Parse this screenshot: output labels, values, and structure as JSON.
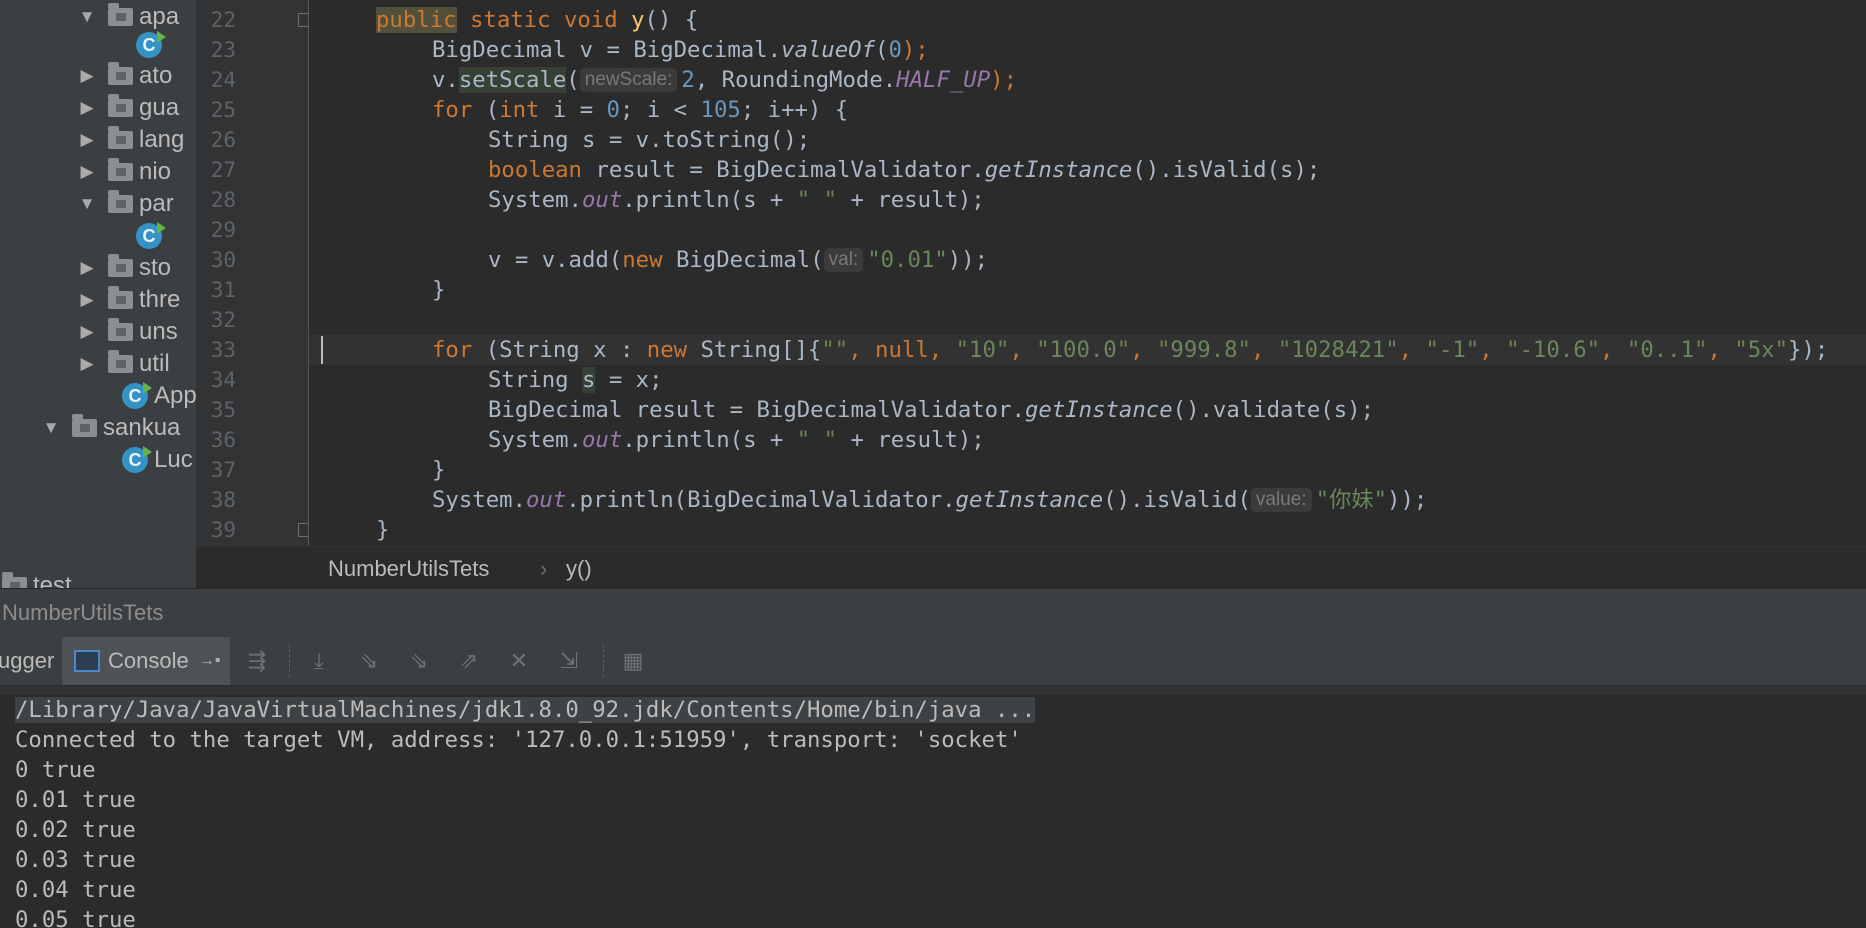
{
  "project_tree": {
    "items": [
      {
        "label": "apa",
        "icon": "folder-icon",
        "expanded": true
      },
      {
        "label": "C",
        "icon": "class-icon"
      },
      {
        "label": "ato",
        "icon": "folder-icon",
        "expanded": false
      },
      {
        "label": "gua",
        "icon": "folder-icon",
        "expanded": false
      },
      {
        "label": "lang",
        "icon": "folder-icon",
        "expanded": false
      },
      {
        "label": "nio",
        "icon": "folder-icon",
        "expanded": false
      },
      {
        "label": "par",
        "icon": "folder-icon",
        "expanded": true
      },
      {
        "label": "C",
        "icon": "class-icon"
      },
      {
        "label": "sto",
        "icon": "folder-icon",
        "expanded": false
      },
      {
        "label": "thre",
        "icon": "folder-icon",
        "expanded": false
      },
      {
        "label": "uns",
        "icon": "folder-icon",
        "expanded": false
      },
      {
        "label": "util",
        "icon": "folder-icon",
        "expanded": false
      },
      {
        "label": "App",
        "icon": "class-icon"
      },
      {
        "label": "sankua",
        "icon": "folder-icon",
        "expanded": true
      },
      {
        "label": "Luc",
        "icon": "class-icon"
      },
      {
        "label": "test",
        "icon": "folder-icon"
      }
    ]
  },
  "editor": {
    "line_numbers": [
      "22",
      "23",
      "24",
      "25",
      "26",
      "27",
      "28",
      "29",
      "30",
      "31",
      "32",
      "33",
      "34",
      "35",
      "36",
      "37",
      "38",
      "39"
    ],
    "code": {
      "l22": [
        "public",
        " ",
        "static void",
        " ",
        "y",
        "() {"
      ],
      "l23": [
        "BigDecimal v = BigDecimal.",
        "valueOf",
        "(",
        "0",
        ");"
      ],
      "l24": [
        "v.",
        "setScale",
        "(",
        "newScale:",
        "2",
        ", RoundingMode.",
        "HALF_UP",
        ");"
      ],
      "l25": [
        "for",
        " (",
        "int",
        " i = ",
        "0",
        "; i < ",
        "105",
        "; i++) {"
      ],
      "l26": [
        "String s = v.toString();"
      ],
      "l27": [
        "boolean",
        " result = BigDecimalValidator.",
        "getInstance",
        "().isValid(s);"
      ],
      "l28": [
        "System.",
        "out",
        ".println(s + ",
        "\" \"",
        " + result);"
      ],
      "l30": [
        "v = v.add(",
        "new",
        " BigDecimal(",
        "val:",
        "\"0.01\"",
        "));"
      ],
      "l31": [
        "}"
      ],
      "l33": [
        "for",
        " (String x : ",
        "new",
        " String[]{",
        "\"\"",
        ", ",
        "null",
        ", ",
        "\"10\"",
        ", ",
        "\"100.0\"",
        ", ",
        "\"999.8\"",
        ", ",
        "\"1028421\"",
        ", ",
        "\"-1\"",
        ", ",
        "\"-10.6\"",
        ", ",
        "\"0..1\"",
        ", ",
        "\"5x\"",
        "});"
      ],
      "l34": [
        "String ",
        "s",
        " = x;"
      ],
      "l35": [
        "BigDecimal result = BigDecimalValidator.",
        "getInstance",
        "().validate(s);"
      ],
      "l36": [
        "System.",
        "out",
        ".println(s + ",
        "\" \"",
        " + result);"
      ],
      "l37": [
        "}"
      ],
      "l38": [
        "System.",
        "out",
        ".println(BigDecimalValidator.",
        "getInstance",
        "().isValid(",
        "value:",
        "\"你妹\"",
        "));"
      ],
      "l39": [
        "}"
      ]
    }
  },
  "breadcrumb": {
    "file": "NumberUtilsTets",
    "separator": "›",
    "method": "y()"
  },
  "run_panel": {
    "title": "NumberUtilsTets",
    "tabs": {
      "debugger": "ugger",
      "console": "Console"
    }
  },
  "console": {
    "lines": [
      "/Library/Java/JavaVirtualMachines/jdk1.8.0_92.jdk/Contents/Home/bin/java ...",
      "Connected to the target VM, address: '127.0.0.1:51959', transport: 'socket'",
      "0 true",
      "0.01 true",
      "0.02 true",
      "0.03 true",
      "0.04 true",
      "0.05 true"
    ]
  }
}
